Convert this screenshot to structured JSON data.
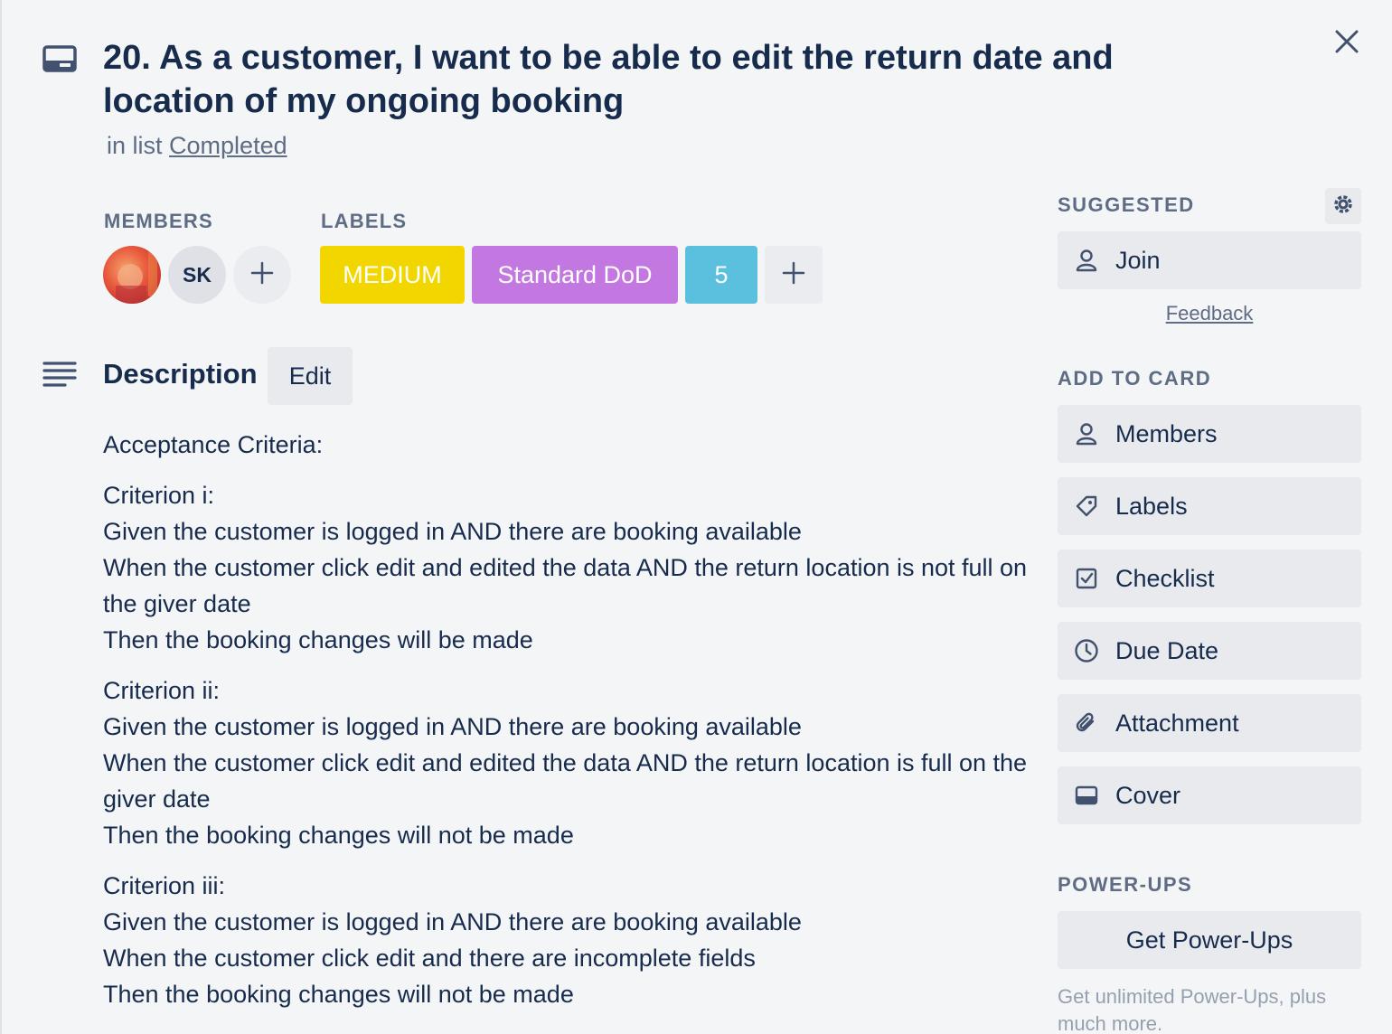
{
  "card": {
    "title": "20. As a customer, I want to be able to edit the return date and location of my ongoing booking",
    "in_list_prefix": "in list",
    "list_name": "Completed"
  },
  "members": {
    "heading": "MEMBERS",
    "initials": "SK"
  },
  "labels": {
    "heading": "LABELS",
    "items": [
      "MEDIUM",
      "Standard DoD",
      "5"
    ],
    "colors": [
      "#f2d600",
      "#c377e0",
      "#5bc0de"
    ]
  },
  "description": {
    "heading": "Description",
    "edit_label": "Edit",
    "paragraphs": [
      [
        "Acceptance Criteria:"
      ],
      [
        "Criterion i:",
        "Given the customer is logged in AND there are booking available",
        "When the customer click edit and edited the data AND the return location is not full on the giver date",
        "Then the booking changes will be made"
      ],
      [
        "Criterion ii:",
        "Given the customer is logged in AND there are booking available",
        "When the customer click edit and edited the data AND the return location is full on the giver date",
        "Then the booking changes will not be made"
      ],
      [
        "Criterion iii:",
        "Given the customer is logged in AND there are booking available",
        "When the customer click edit and there are incomplete fields",
        "Then the booking changes will not be made"
      ]
    ]
  },
  "sidebar": {
    "suggested_heading": "SUGGESTED",
    "join_label": "Join",
    "feedback_label": "Feedback",
    "add_to_card_heading": "ADD TO CARD",
    "add_items": [
      {
        "label": "Members",
        "icon": "person-icon"
      },
      {
        "label": "Labels",
        "icon": "tag-icon"
      },
      {
        "label": "Checklist",
        "icon": "checklist-icon"
      },
      {
        "label": "Due Date",
        "icon": "clock-icon"
      },
      {
        "label": "Attachment",
        "icon": "paperclip-icon"
      },
      {
        "label": "Cover",
        "icon": "cover-icon"
      }
    ],
    "powerups_heading": "POWER-UPS",
    "get_powerups_label": "Get Power-Ups",
    "powerups_note": "Get unlimited Power-Ups, plus much more."
  },
  "colors": {
    "text": "#172b4d",
    "muted": "#5e6c84",
    "button_bg": "#e8eaee",
    "page_bg": "#f4f5f7"
  }
}
